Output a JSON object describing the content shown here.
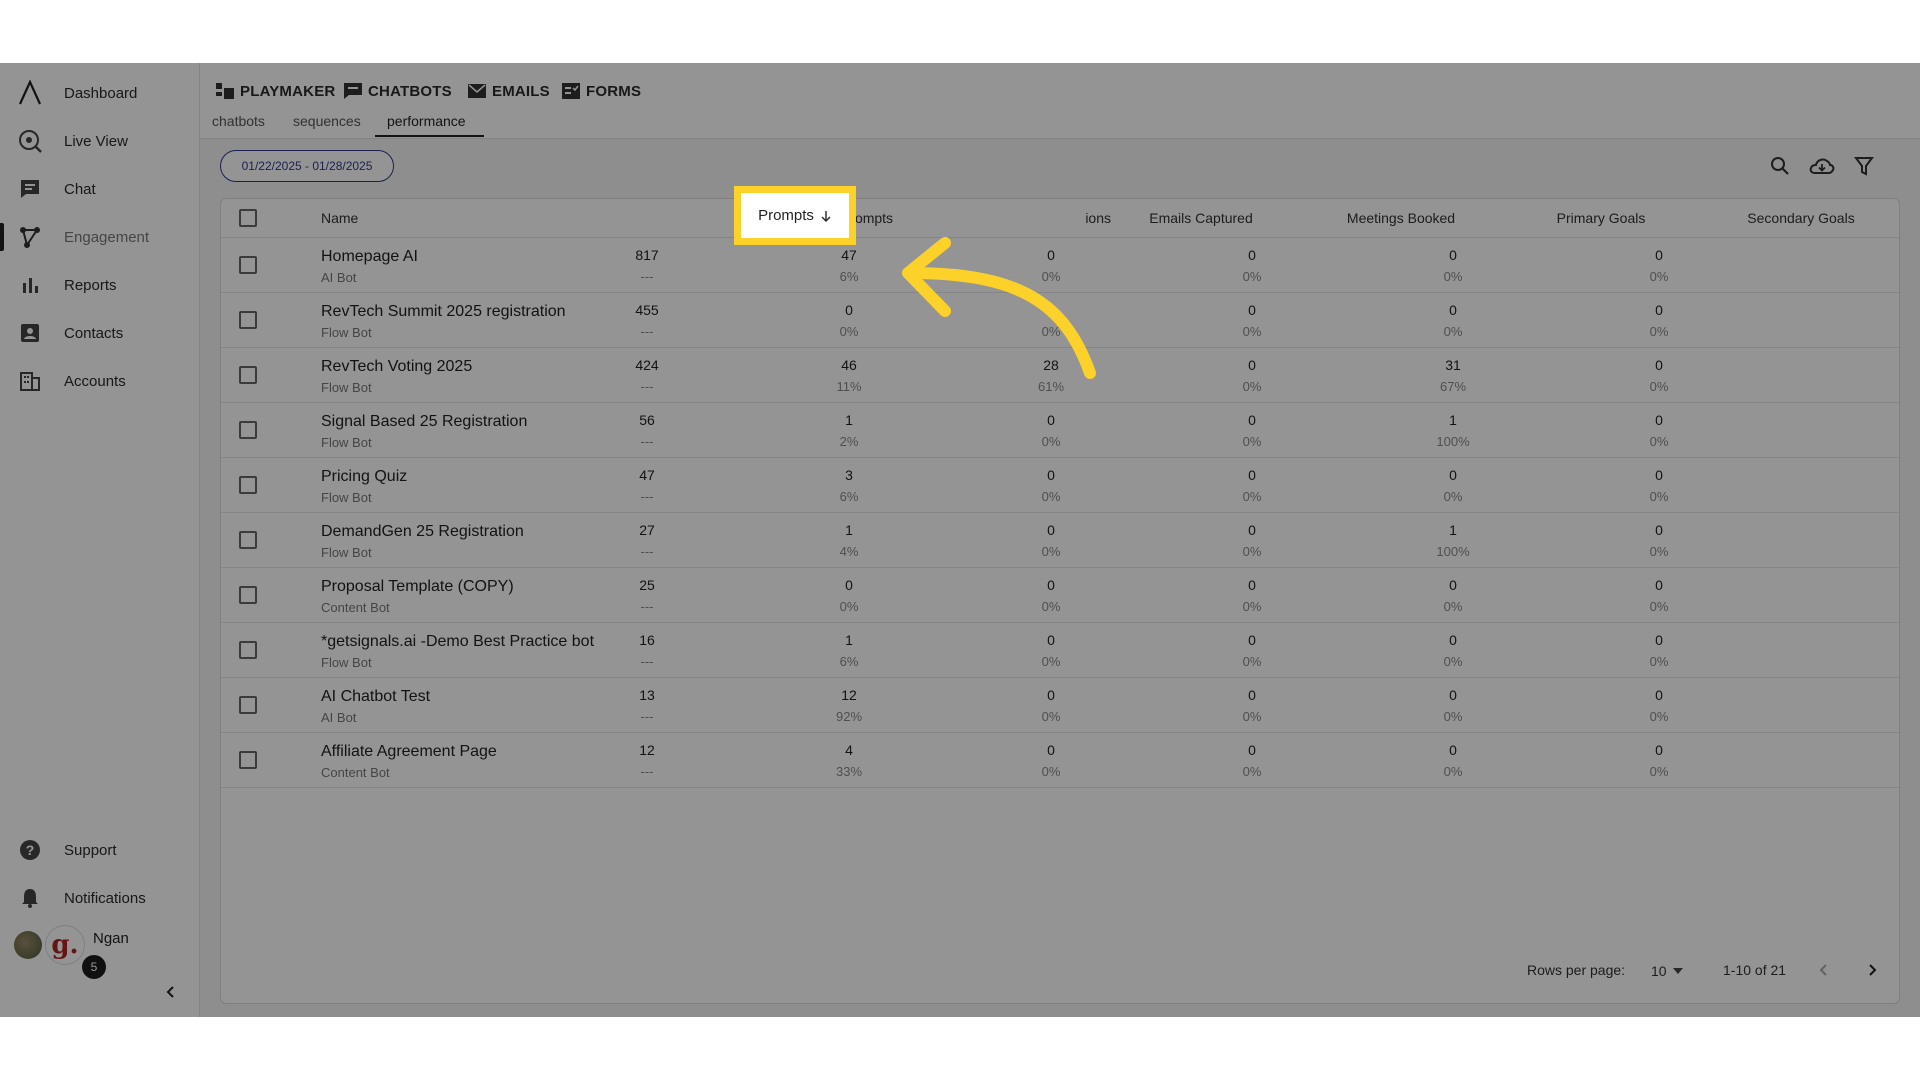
{
  "sidebar": {
    "items": [
      {
        "label": "Dashboard",
        "icon": "logo-a-icon"
      },
      {
        "label": "Live View",
        "icon": "live-view-icon"
      },
      {
        "label": "Chat",
        "icon": "chat-icon"
      },
      {
        "label": "Engagement",
        "icon": "engagement-icon"
      },
      {
        "label": "Reports",
        "icon": "bar-chart-icon"
      },
      {
        "label": "Contacts",
        "icon": "contacts-icon"
      },
      {
        "label": "Accounts",
        "icon": "building-icon"
      }
    ],
    "bottom": [
      {
        "label": "Support",
        "icon": "help-icon"
      },
      {
        "label": "Notifications",
        "icon": "bell-icon"
      }
    ],
    "user": {
      "name": "Ngan",
      "avatar_letter": "g.",
      "badge": "5"
    }
  },
  "tabs": {
    "main": [
      {
        "label": "PLAYMAKER",
        "icon": "playmaker-icon"
      },
      {
        "label": "CHATBOTS",
        "icon": "chatbot-icon"
      },
      {
        "label": "EMAILS",
        "icon": "mail-icon"
      },
      {
        "label": "FORMS",
        "icon": "form-icon"
      }
    ],
    "sub": [
      "chatbots",
      "sequences",
      "performance"
    ],
    "active_sub": "performance"
  },
  "toolbar": {
    "date_range": "01/22/2025 - 01/28/2025"
  },
  "table": {
    "headers": {
      "name": "Name",
      "prompts": "Prompts",
      "conversations": "ions",
      "emails": "Emails Captured",
      "meetings": "Meetings Booked",
      "primary": "Primary Goals",
      "secondary": "Secondary Goals"
    },
    "rows": [
      {
        "name": "Homepage AI",
        "type": "AI Bot",
        "prompts": "817",
        "prompts_pct": "---",
        "conv": "47",
        "conv_pct": "6%",
        "emails": "0",
        "emails_pct": "0%",
        "meetings": "0",
        "meetings_pct": "0%",
        "primary": "0",
        "primary_pct": "0%",
        "secondary": "0",
        "secondary_pct": "0%"
      },
      {
        "name": "RevTech Summit 2025 registration",
        "type": "Flow Bot",
        "prompts": "455",
        "prompts_pct": "---",
        "conv": "0",
        "conv_pct": "0%",
        "emails": "0",
        "emails_pct": "0%",
        "meetings": "0",
        "meetings_pct": "0%",
        "primary": "0",
        "primary_pct": "0%",
        "secondary": "0",
        "secondary_pct": "0%"
      },
      {
        "name": "RevTech Voting 2025",
        "type": "Flow Bot",
        "prompts": "424",
        "prompts_pct": "---",
        "conv": "46",
        "conv_pct": "11%",
        "emails": "28",
        "emails_pct": "61%",
        "meetings": "0",
        "meetings_pct": "0%",
        "primary": "31",
        "primary_pct": "67%",
        "secondary": "0",
        "secondary_pct": "0%"
      },
      {
        "name": "Signal Based 25 Registration",
        "type": "Flow Bot",
        "prompts": "56",
        "prompts_pct": "---",
        "conv": "1",
        "conv_pct": "2%",
        "emails": "0",
        "emails_pct": "0%",
        "meetings": "0",
        "meetings_pct": "0%",
        "primary": "1",
        "primary_pct": "100%",
        "secondary": "0",
        "secondary_pct": "0%"
      },
      {
        "name": "Pricing Quiz",
        "type": "Flow Bot",
        "prompts": "47",
        "prompts_pct": "---",
        "conv": "3",
        "conv_pct": "6%",
        "emails": "0",
        "emails_pct": "0%",
        "meetings": "0",
        "meetings_pct": "0%",
        "primary": "0",
        "primary_pct": "0%",
        "secondary": "0",
        "secondary_pct": "0%"
      },
      {
        "name": "DemandGen 25 Registration",
        "type": "Flow Bot",
        "prompts": "27",
        "prompts_pct": "---",
        "conv": "1",
        "conv_pct": "4%",
        "emails": "0",
        "emails_pct": "0%",
        "meetings": "0",
        "meetings_pct": "0%",
        "primary": "1",
        "primary_pct": "100%",
        "secondary": "0",
        "secondary_pct": "0%"
      },
      {
        "name": "Proposal Template (COPY)",
        "type": "Content Bot",
        "prompts": "25",
        "prompts_pct": "---",
        "conv": "0",
        "conv_pct": "0%",
        "emails": "0",
        "emails_pct": "0%",
        "meetings": "0",
        "meetings_pct": "0%",
        "primary": "0",
        "primary_pct": "0%",
        "secondary": "0",
        "secondary_pct": "0%"
      },
      {
        "name": "*getsignals.ai -Demo Best Practice bot",
        "type": "Flow Bot",
        "prompts": "16",
        "prompts_pct": "---",
        "conv": "1",
        "conv_pct": "6%",
        "emails": "0",
        "emails_pct": "0%",
        "meetings": "0",
        "meetings_pct": "0%",
        "primary": "0",
        "primary_pct": "0%",
        "secondary": "0",
        "secondary_pct": "0%"
      },
      {
        "name": "AI Chatbot Test",
        "type": "AI Bot",
        "prompts": "13",
        "prompts_pct": "---",
        "conv": "12",
        "conv_pct": "92%",
        "emails": "0",
        "emails_pct": "0%",
        "meetings": "0",
        "meetings_pct": "0%",
        "primary": "0",
        "primary_pct": "0%",
        "secondary": "0",
        "secondary_pct": "0%"
      },
      {
        "name": "Affiliate Agreement Page",
        "type": "Content Bot",
        "prompts": "12",
        "prompts_pct": "---",
        "conv": "4",
        "conv_pct": "33%",
        "emails": "0",
        "emails_pct": "0%",
        "meetings": "0",
        "meetings_pct": "0%",
        "primary": "0",
        "primary_pct": "0%",
        "secondary": "0",
        "secondary_pct": "0%"
      }
    ]
  },
  "pagination": {
    "rows_label": "Rows per page:",
    "rows_value": "10",
    "range": "1-10 of 21"
  },
  "colors": {
    "highlight": "#fcd12a",
    "accent": "#2e3a8c"
  }
}
